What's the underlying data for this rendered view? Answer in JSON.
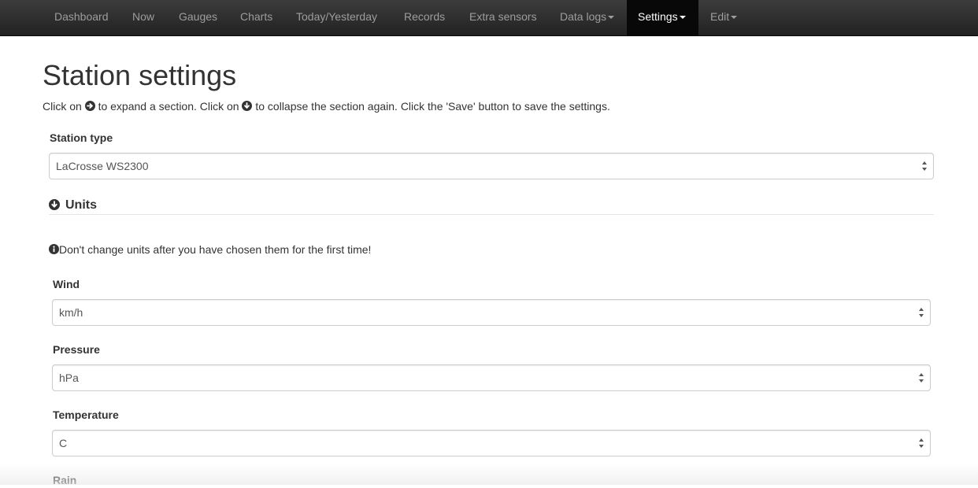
{
  "nav": {
    "items": [
      {
        "label": "Dashboard"
      },
      {
        "label": "Now"
      },
      {
        "label": "Gauges"
      },
      {
        "label": "Charts"
      },
      {
        "label": "Today/Yesterday"
      },
      {
        "label": "Records"
      },
      {
        "label": "Extra sensors"
      },
      {
        "label": "Data logs"
      },
      {
        "label": "Settings"
      },
      {
        "label": "Edit"
      }
    ],
    "active": "Settings"
  },
  "page": {
    "title": "Station settings",
    "intro": {
      "part1": "Click on",
      "part2": "to expand a section. Click on",
      "part3": "to collapse the section again. Click the 'Save' button to save the settings."
    }
  },
  "station_type": {
    "label": "Station type",
    "value": "LaCrosse WS2300"
  },
  "units_section": {
    "title": "Units",
    "warning": "Don't change units after you have chosen them for the first time!",
    "fields": [
      {
        "label": "Wind",
        "value": "km/h"
      },
      {
        "label": "Pressure",
        "value": "hPa"
      },
      {
        "label": "Temperature",
        "value": "C"
      },
      {
        "label": "Rain"
      }
    ]
  },
  "icons": {
    "expand": "circle-arrow-right-icon",
    "collapse": "circle-arrow-down-icon",
    "info": "info-sign-icon"
  }
}
